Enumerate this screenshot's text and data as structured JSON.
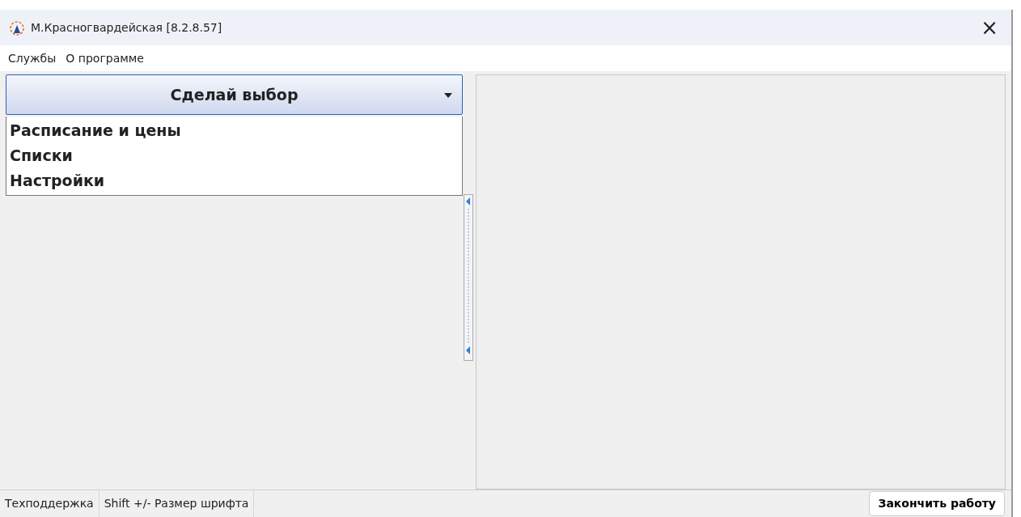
{
  "window": {
    "title": "М.Красногвардейская [8.2.8.57]",
    "close": "×"
  },
  "menu": [
    {
      "label": "Службы"
    },
    {
      "label": "О программе"
    }
  ],
  "selector": {
    "label": "Сделай выбор",
    "expanded": true
  },
  "options": [
    {
      "label": "Расписание и цены"
    },
    {
      "label": "Списки"
    },
    {
      "label": "Настройки"
    }
  ],
  "status_bar": {
    "items": [
      "Техподдержка",
      "Shift +/- Размер шрифта"
    ],
    "button": "Закончить работу"
  }
}
